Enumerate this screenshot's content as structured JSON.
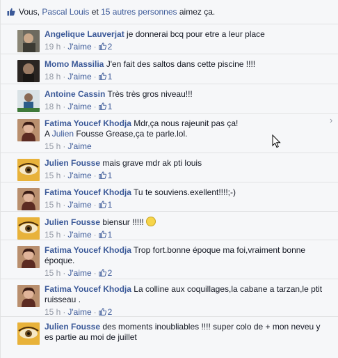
{
  "likes_bar": {
    "prefix": "Vous,",
    "person": "Pascal Louis",
    "and": "et",
    "others": "15 autres personnes",
    "suffix": "aimez ça."
  },
  "like_label": "J'aime",
  "comments": [
    {
      "author": "Angelique Lauverjat",
      "text": "je donnerai bcq pour etre a leur place",
      "text2": "",
      "time": "19 h",
      "likes": "2"
    },
    {
      "author": "Momo Massilia",
      "text": "J'en fait des saltos dans cette piscine !!!!",
      "text2": "",
      "time": "18 h",
      "likes": "1"
    },
    {
      "author": "Antoine Cassin",
      "text": "Très très gros niveau!!!",
      "text2": "",
      "time": "18 h",
      "likes": "1"
    },
    {
      "author": "Fatima Youcef Khodja",
      "text": "Mdr,ça nous rajeunit pas ça!",
      "line2_prefix": "A",
      "line2_link": "Julien",
      "line2_rest": "Fousse Grease,ça te parle.lol.",
      "time": "15 h",
      "likes": ""
    },
    {
      "author": "Julien Fousse",
      "text": "mais grave mdr ak pti louis",
      "text2": "",
      "time": "15 h",
      "likes": "1"
    },
    {
      "author": "Fatima Youcef Khodja",
      "text": "Tu te souviens.exellent!!!!;-)",
      "text2": "",
      "time": "15 h",
      "likes": "1"
    },
    {
      "author": "Julien Fousse",
      "text": "biensur !!!!!",
      "text2": "",
      "time": "15 h",
      "likes": "1"
    },
    {
      "author": "Fatima Youcef Khodja",
      "text": "Trop fort.bonne époque ma foi,vraiment bonne",
      "text2": "époque.",
      "time": "15 h",
      "likes": "2"
    },
    {
      "author": "Fatima Youcef Khodja",
      "text": "La colline aux coquillages,la cabane a tarzan,le ptit",
      "text2": "ruisseau .",
      "time": "15 h",
      "likes": "2"
    },
    {
      "author": "Julien Fousse",
      "text": "des moments inoubliables !!!! super colo de + mon neveu y",
      "text2": "es partie au moi de juillet",
      "time": "",
      "likes": ""
    }
  ]
}
